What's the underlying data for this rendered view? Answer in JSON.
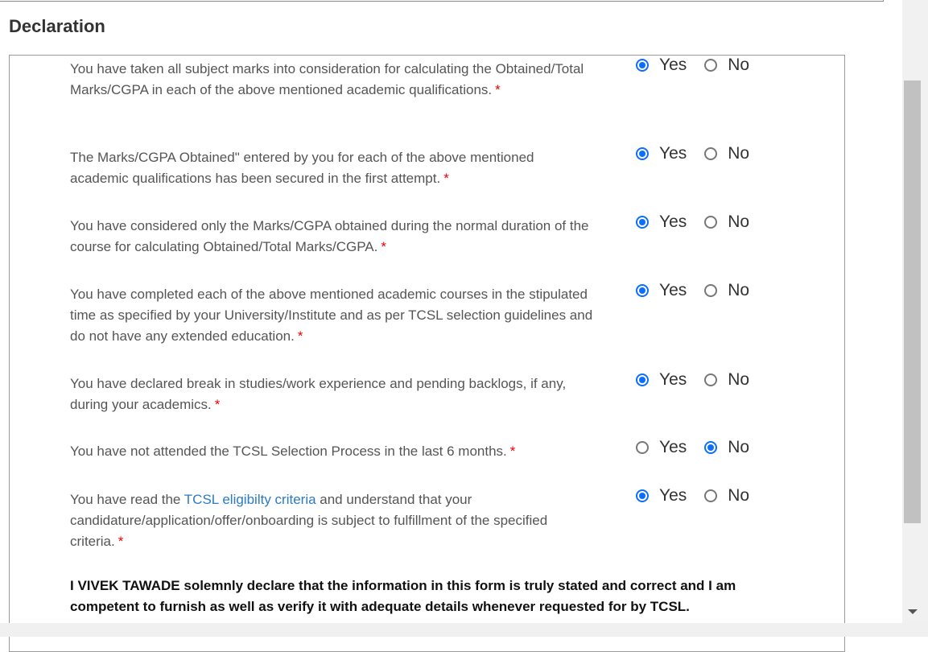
{
  "section_title": "Declaration",
  "options": {
    "yes": "Yes",
    "no": "No"
  },
  "required_mark": "*",
  "questions": [
    {
      "text": "You have taken all subject marks into consideration for calculating the Obtained/Total Marks/CGPA in each of the above mentioned academic qualifications.",
      "selected": "yes"
    },
    {
      "text": "The Marks/CGPA Obtained\" entered by you for each of the above mentioned academic qualifications has been secured in the first attempt.",
      "selected": "yes"
    },
    {
      "text": "You have considered only the Marks/CGPA obtained during the normal duration of the course for calculating Obtained/Total Marks/CGPA.",
      "selected": "yes"
    },
    {
      "text": "You have completed each of the above mentioned academic courses in the stipulated time as specified by your University/Institute and as per TCSL selection guidelines and do not have any extended education.",
      "selected": "yes"
    },
    {
      "text": "You have declared break in studies/work experience and pending backlogs, if any, during your academics.",
      "selected": "yes"
    },
    {
      "text": "You have not attended the TCSL Selection Process in the last 6 months.",
      "selected": "no"
    },
    {
      "text_before": "You have read the ",
      "link": "TCSL eligibilty criteria",
      "text_after": " and understand that your candidature/application/offer/onboarding is subject to fulfillment of the specified criteria.",
      "selected": "yes"
    }
  ],
  "declaration": "I VIVEK TAWADE solemnly declare that the information in this form is truly stated and correct and I am competent to furnish as well as verify it with adequate details whenever requested for by TCSL.",
  "accent_color": "#0d6efd"
}
